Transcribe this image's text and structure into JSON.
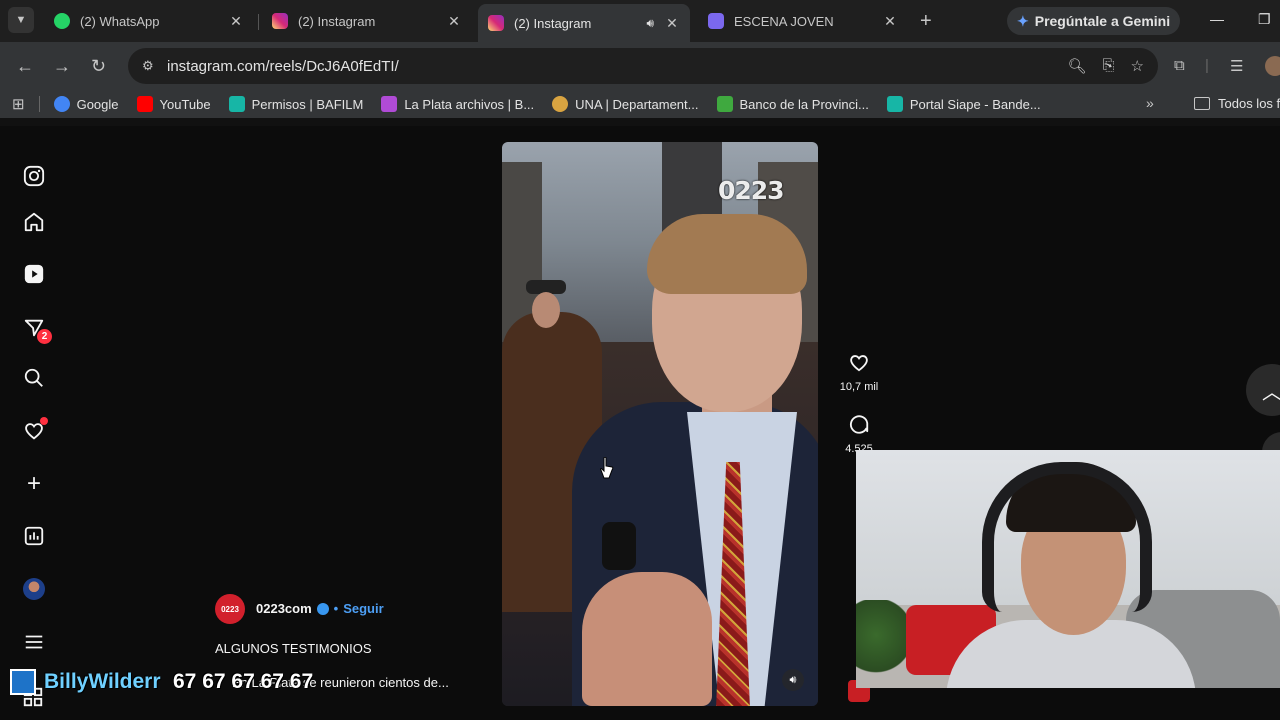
{
  "browser": {
    "tabs": [
      {
        "title": "(2) WhatsApp",
        "icon": "whatsapp-icon",
        "color": "#25d366"
      },
      {
        "title": "(2) Instagram",
        "icon": "instagram-icon",
        "color": "#e1306c"
      },
      {
        "title": "(2) Instagram",
        "icon": "instagram-icon",
        "color": "#e1306c",
        "active": true
      },
      {
        "title": "ESCENA JOVEN",
        "icon": "doc-icon",
        "color": "#7b68ee"
      }
    ],
    "gemini_label": "Pregúntale a Gemini",
    "url": "instagram.com/reels/DcJ6A0fEdTI/",
    "bookmarks": [
      {
        "label": "Google",
        "color": "#4285f4"
      },
      {
        "label": "YouTube",
        "color": "#ff0000"
      },
      {
        "label": "Permisos | BAFILM",
        "color": "#17b6a6"
      },
      {
        "label": "La Plata archivos | B...",
        "color": "#b04bd6"
      },
      {
        "label": "UNA | Departament...",
        "color": "#d9a441"
      },
      {
        "label": "Banco de la Provinci...",
        "color": "#3fa93f"
      },
      {
        "label": "Portal Siape - Bande...",
        "color": "#17b6a6"
      }
    ],
    "bookmarks_folder": "Todos los fa"
  },
  "sidebar": {
    "notifications_badge": "2"
  },
  "reel": {
    "watermark": "0223",
    "likes": "10,7 mil",
    "comments": "4.525",
    "author": "0223com",
    "author_avatar_text": "0223",
    "separator": "•",
    "follow_label": "Seguir",
    "caption_title": "ALGUNOS TESTIMONIOS",
    "caption": "En La Plata se reunieron cientos de..."
  },
  "stream": {
    "name": "BillyWilderr",
    "code": "67 67 67 67 67"
  },
  "colors": {
    "accent": "#4d9ff5",
    "badge": "#ff3040"
  }
}
